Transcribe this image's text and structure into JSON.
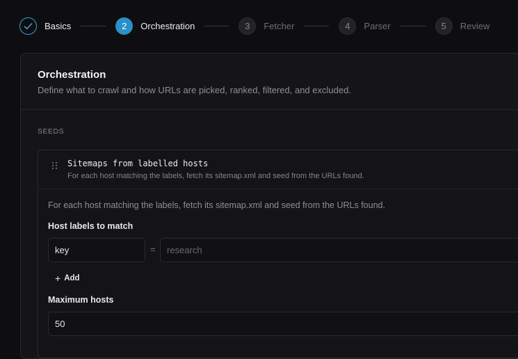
{
  "stepper": {
    "steps": [
      {
        "number": "",
        "label": "Basics",
        "state": "done"
      },
      {
        "number": "2",
        "label": "Orchestration",
        "state": "active"
      },
      {
        "number": "3",
        "label": "Fetcher",
        "state": "pending"
      },
      {
        "number": "4",
        "label": "Parser",
        "state": "pending"
      },
      {
        "number": "5",
        "label": "Review",
        "state": "pending"
      }
    ]
  },
  "card": {
    "title": "Orchestration",
    "description": "Define what to crawl and how URLs are picked, ranked, filtered, and excluded."
  },
  "seeds": {
    "section_label": "SEEDS",
    "item": {
      "title": "Sitemaps from labelled hosts",
      "subtitle": "For each host matching the labels, fetch its sitemap.xml and seed from the URLs found.",
      "body_description": "For each host matching the labels, fetch its sitemap.xml and seed from the URLs found.",
      "host_labels": {
        "label": "Host labels to match",
        "key_value": "key",
        "separator": "=",
        "value_placeholder": "research",
        "add_label": "Add"
      },
      "max_hosts": {
        "label": "Maximum hosts",
        "value": "50"
      }
    }
  },
  "colors": {
    "accent": "#2b8fc9",
    "background": "#0e0e10",
    "card": "#151517"
  }
}
